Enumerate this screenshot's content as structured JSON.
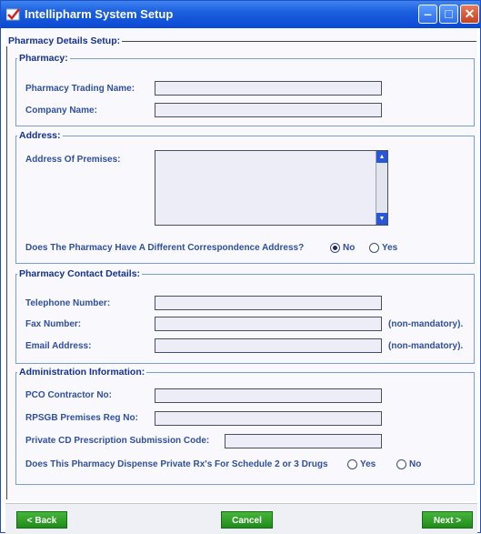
{
  "window": {
    "title": "Intellipharm System Setup"
  },
  "outer": {
    "legend": "Pharmacy Details Setup:"
  },
  "pharmacy": {
    "legend": "Pharmacy:",
    "trading_name_label": "Pharmacy Trading Name:",
    "trading_name_value": "",
    "company_name_label": "Company Name:",
    "company_name_value": ""
  },
  "address": {
    "legend": "Address:",
    "premises_label": "Address Of Premises:",
    "premises_value": "",
    "different_question": "Does The Pharmacy Have A Different Correspondence Address?",
    "option_no": "No",
    "option_yes": "Yes",
    "selected": "No"
  },
  "contact": {
    "legend": "Pharmacy Contact Details:",
    "telephone_label": "Telephone Number:",
    "telephone_value": "",
    "fax_label": "Fax Number:",
    "fax_value": "",
    "fax_note": "(non-mandatory).",
    "email_label": "Email Address:",
    "email_value": "",
    "email_note": "(non-mandatory)."
  },
  "admin": {
    "legend": "Administration Information:",
    "pco_label": "PCO Contractor No:",
    "pco_value": "",
    "rpsgb_label": "RPSGB Premises Reg No:",
    "rpsgb_value": "",
    "private_cd_label": "Private CD Prescription Submission Code:",
    "private_cd_value": "",
    "dispense_question": "Does This Pharmacy Dispense Private Rx's For Schedule 2 or 3 Drugs",
    "option_yes": "Yes",
    "option_no": "No",
    "selected": ""
  },
  "buttons": {
    "back": "< Back",
    "cancel": "Cancel",
    "next": "Next >"
  },
  "colors": {
    "title_bar": "#1c5fe0",
    "label": "#2f4f9f",
    "legend": "#15318f",
    "button": "#1f8c1a"
  },
  "icons": {
    "title": "checkmark-app-icon",
    "minimize": "minimize-icon",
    "maximize": "maximize-icon",
    "close": "close-icon"
  }
}
